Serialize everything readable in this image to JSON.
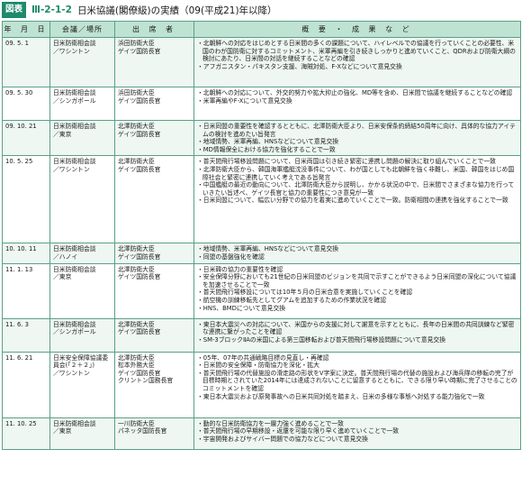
{
  "title": {
    "badge": "図表",
    "figure_no": "Ⅲ-2-1-2",
    "text": "日米協議(閣僚級)の実績（09(平成21)年以降）"
  },
  "headers": [
    "年 月 日",
    "会議／場所",
    "出 席 者",
    "概 要 ・ 成 果 な ど"
  ],
  "rows": [
    {
      "date": "09. 5. 1",
      "meeting": "日米防衛相会談\n／ワシントン",
      "attendees": "浜田防衛大臣\nゲイツ国防長官",
      "outcomes": [
        "・北朝鮮への対応をはじめとする日米間の多くの課題について、ハイレベルでの協議を行っていくことの必要性、米国のわが国防衛に対するコミットメント、米軍再編を引き続きしっかりと進めていくこと、QDRおよび防衛大綱の検討にあたり、日米間の対話を継続することなどの確認",
        "・アフガニスタン・パキスタン支援、海賊対処、F-Xなどについて意見交換"
      ]
    },
    {
      "date": "09. 5. 30",
      "meeting": "日米防衛相会談\n／シンガポール",
      "attendees": "浜田防衛大臣\nゲイツ国防長官",
      "outcomes": [
        "・北朝鮮への対応について、外交的努力や拡大抑止の強化、MD等を含め、日米間で協議を継続することなどの確認",
        "・米軍再編やF-Xについて意見交換"
      ]
    },
    {
      "date": "09. 10. 21",
      "meeting": "日米防衛相会談\n／東京",
      "attendees": "北澤防衛大臣\nゲイツ国防長官",
      "outcomes": [
        "・日米同盟の重要性を確認するとともに、北澤防衛大臣より、日米安保条約締結50周年に向け、具体的な協力アイテムの検討を進めたい旨発言",
        "・地域情勢、米軍再編、HNSなどについて意見交換",
        "・MD情報保全における協力を強化することで一致"
      ]
    },
    {
      "date": "10. 5. 25",
      "meeting": "日米防衛相会談\n／ワシントン",
      "attendees": "北澤防衛大臣\nゲイツ国防長官",
      "outcomes": [
        "・普天間飛行場移設問題について、日米両国は引き続き緊密に連携し問題の解決に取り組んでいくことで一致",
        "・北澤防衛大臣から、韓国海軍艦艇沈没事件について、わが国としても北朝鮮を強く非難し、米国、韓国をはじめ国際社会と緊密に連携していく考えである旨発言",
        "・中国艦艇の最近の動向について、北澤防衛大臣から説明し、かかる状況の中で、日米間でさまざまな協力を行っていきたい旨述べ、ゲイツ長官と協力の重要性につき意見が一致",
        "・日米同盟について、幅広い分野での協力を着実に進めていくことで一致。防衛相間の連携を強化することで一致"
      ]
    },
    {
      "date": "10. 10. 11",
      "meeting": "日米防衛相会談\n／ハノイ",
      "attendees": "北澤防衛大臣\nゲイツ国防長官",
      "outcomes": [
        "・地域情勢、米軍再編、HNSなどについて意見交換",
        "・同盟の基盤強化を確認"
      ]
    },
    {
      "date": "11. 1. 13",
      "meeting": "日米防衛相会談\n／東京",
      "attendees": "北澤防衛大臣\nゲイツ国防長官",
      "outcomes": [
        "・日米韓の協力の重要性を確認",
        "・安全保障分野においても21世紀の日米同盟のビジョンを共同で示すことができるよう日米同盟の深化について協議を加速させることで一致",
        "・普天間飛行場移設については10年５月の日米合意を実施していくことを確認",
        "・航空機の訓練移転先としてグアムを追加するための作業状況を確認",
        "・HNS、BMDについて意見交換"
      ]
    },
    {
      "date": "11. 6. 3",
      "meeting": "日米防衛相会談\n／シンガポール",
      "attendees": "北澤防衛大臣\nゲイツ国防長官",
      "outcomes": [
        "・東日本大震災への対応について、米国からの支援に対して謝意を示すとともに、長年の日米間の共同訓練など緊密な連携に繋がったことを確認",
        "・SM-3ブロックⅡAの米国による第三国移転および普天間飛行場移設問題について意見交換"
      ]
    },
    {
      "date": "11. 6. 21",
      "meeting": "日米安全保障協議委員会(「２＋２」)\n／ワシントン",
      "attendees": "北澤防衛大臣\n松本外務大臣\nゲイツ国防長官\nクリントン国務長官",
      "outcomes": [
        "・05年、07年の共通戦略目標の見直し・再確認",
        "・日米間の安全保障・防衛協力を深化・拡大",
        "・普天間飛行場の代替施設の滑走路の形状をV字案に決定。普天間飛行場の代替の施設および海兵隊の移転の完了が目標時期とされていた2014年には達成されないことに留意するとともに、できる限り早い時期に完了させることのコミットメントを確認",
        "・東日本大震災および原発事故への日米共同対処を踏まえ、日米の多様な事態へ対処する能力強化で一致"
      ]
    },
    {
      "date": "11. 10. 25",
      "meeting": "日米防衛相会談\n／東京",
      "attendees": "一川防衛大臣\nパネッタ国防長官",
      "outcomes": [
        "・動的な日米防衛協力を一層力強く進めることで一致",
        "・普天間飛行場の早期移設・返還を可能な限り早く進めていくことで一致",
        "・宇宙開発およびサイバー問題での協力などについて意見交換"
      ]
    }
  ]
}
